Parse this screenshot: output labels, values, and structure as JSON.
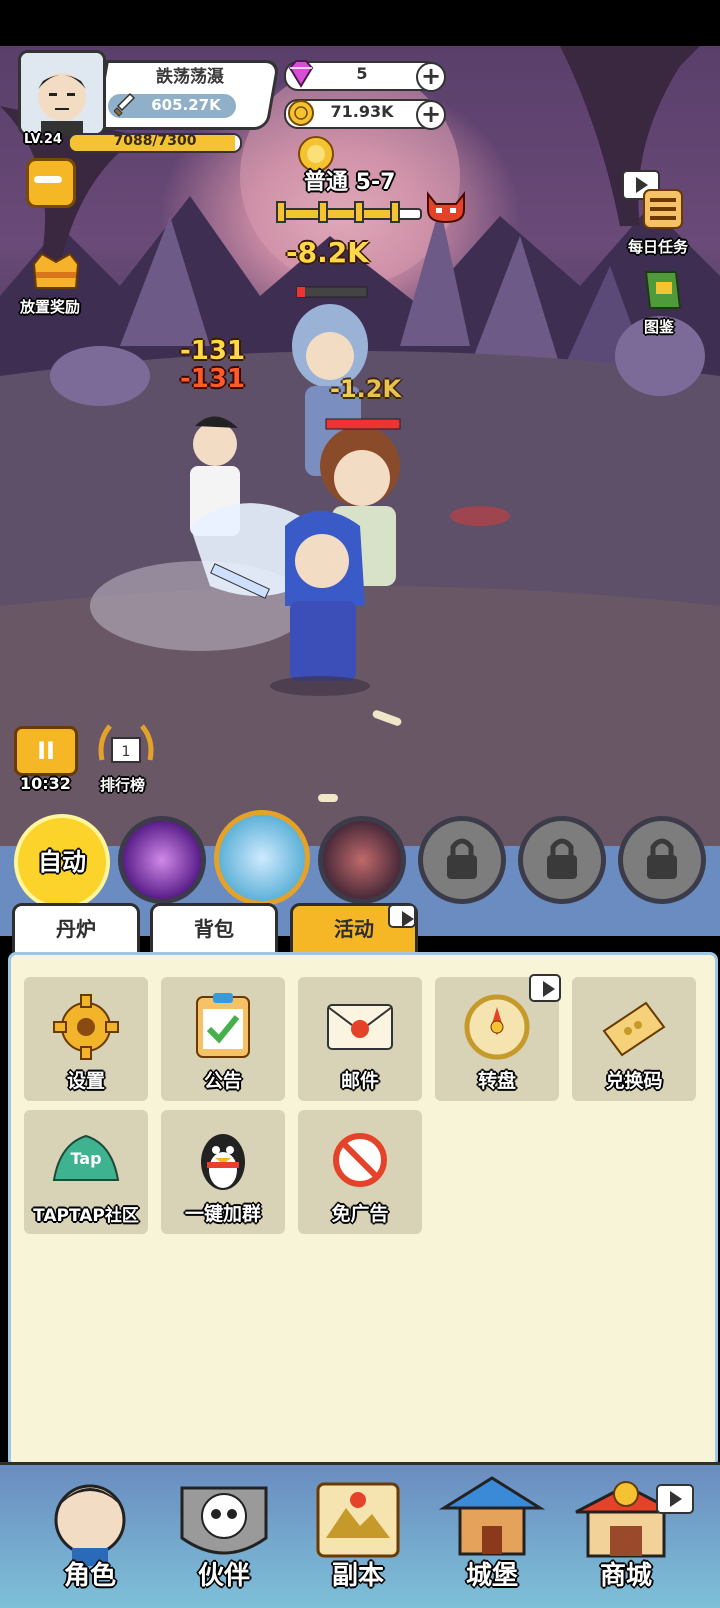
{
  "player": {
    "name": "詄荡荡滠",
    "power": "605.27K",
    "level": "LV.24",
    "exp_text": "7088/7300",
    "exp_fraction": 0.971
  },
  "currency": {
    "diamonds": "5",
    "gold": "71.93K",
    "plus_symbol": "+"
  },
  "stage": {
    "label": "普通 5-7",
    "progress_fraction": 0.86
  },
  "side_buttons": {
    "idle_reward": "放置奖励",
    "daily_tasks": "每日任务",
    "codex": "图鉴",
    "leaderboard": "排行榜"
  },
  "battle": {
    "damage_texts": [
      "-8.2K",
      "-131",
      "-131",
      "-1.2K"
    ],
    "timer": "10:32",
    "pause_symbol": "II"
  },
  "skills": {
    "auto_label": "自动"
  },
  "tabs": [
    {
      "label": "丹炉"
    },
    {
      "label": "背包"
    },
    {
      "label": "活动"
    }
  ],
  "activity_tiles": [
    {
      "label": "设置",
      "icon": "gear-icon"
    },
    {
      "label": "公告",
      "icon": "notice-board-icon"
    },
    {
      "label": "邮件",
      "icon": "mail-icon"
    },
    {
      "label": "转盘",
      "icon": "wheel-icon"
    },
    {
      "label": "兑换码",
      "icon": "ticket-icon"
    },
    {
      "label": "TAPTAP社区",
      "icon": "taptap-icon"
    },
    {
      "label": "一键加群",
      "icon": "qq-penguin-icon"
    },
    {
      "label": "免广告",
      "icon": "no-ads-icon"
    }
  ],
  "bottom_nav": [
    {
      "label": "角色"
    },
    {
      "label": "伙伴"
    },
    {
      "label": "副本"
    },
    {
      "label": "城堡"
    },
    {
      "label": "商城"
    }
  ],
  "colors": {
    "accent_gold": "#f5c332",
    "panel_bg": "#f7f4d8",
    "nav_bg": "#6a8cc0"
  }
}
